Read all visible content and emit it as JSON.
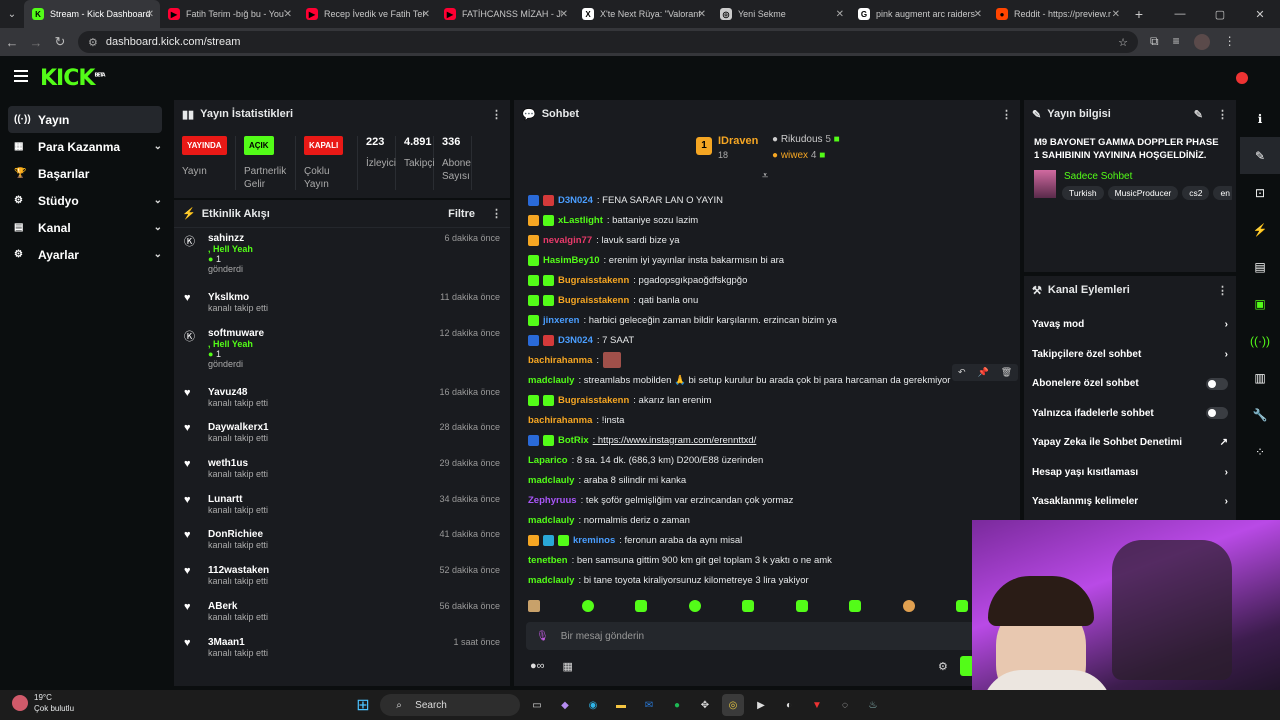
{
  "browser": {
    "tabs": [
      {
        "title": "Stream - Kick Dashboard",
        "fav": "K",
        "color": "#53fc18",
        "active": true
      },
      {
        "title": "Fatih Terim -bığ bu - YouT",
        "fav": "▶",
        "color": "#ff0033"
      },
      {
        "title": "Recep İvedik ve Fatih Teri",
        "fav": "▶",
        "color": "#ff0033"
      },
      {
        "title": "FATİHCANSS MİZAH - JET",
        "fav": "▶",
        "color": "#ff0033"
      },
      {
        "title": "X'te Next Rüya: \"Valorant",
        "fav": "X",
        "color": "#ffffff"
      },
      {
        "title": "Yeni Sekme",
        "fav": "◎",
        "color": "#cccccc"
      },
      {
        "title": "pink augment arc raiders",
        "fav": "G",
        "color": "#ffffff"
      },
      {
        "title": "Reddit - https://preview.r",
        "fav": "●",
        "color": "#ff4500"
      }
    ],
    "url": "dashboard.kick.com/stream"
  },
  "logo": {
    "text": "KICK",
    "beta": "BETA"
  },
  "sidebar": {
    "items": [
      {
        "label": "Yayın",
        "icon": "broadcast-icon",
        "glyph": "((·))",
        "active": true,
        "chevron": false
      },
      {
        "label": "Para Kazanma",
        "icon": "money-icon",
        "glyph": "▦",
        "chevron": true
      },
      {
        "label": "Başarılar",
        "icon": "trophy-icon",
        "glyph": "🏆",
        "chevron": false
      },
      {
        "label": "Stüdyo",
        "icon": "studio-icon",
        "glyph": "⚙",
        "chevron": true
      },
      {
        "label": "Kanal",
        "icon": "channel-icon",
        "glyph": "▤",
        "chevron": true
      },
      {
        "label": "Ayarlar",
        "icon": "settings-icon",
        "glyph": "⚙",
        "chevron": true
      }
    ]
  },
  "stats_panel": {
    "title": "Yayın İstatistikleri",
    "items": [
      {
        "badge": "YAYINDA",
        "badge_color": "#e91916",
        "label": "Yayın"
      },
      {
        "badge": "AÇIK",
        "badge_color": "#53fc18",
        "label": "Partnerlik Gelir Programı"
      },
      {
        "badge": "KAPALI",
        "badge_color": "#e91916",
        "label": "Çoklu Yayın"
      },
      {
        "num": "223",
        "label": "İzleyici"
      },
      {
        "num": "4.891",
        "label": "Takipçi"
      },
      {
        "num": "336",
        "label": "Abone Sayısı"
      }
    ]
  },
  "activity": {
    "title": "Etkinlik Akışı",
    "filter": "Filtre",
    "items": [
      {
        "name": "sahinzz",
        "type": "gift",
        "gift_name": ", Hell Yeah",
        "gift_count": "1",
        "action": "gönderdi",
        "time": "6 dakika önce"
      },
      {
        "name": "Ykslkmo",
        "type": "follow",
        "action": "kanalı takip etti",
        "time": "11 dakika önce"
      },
      {
        "name": "softmuware",
        "type": "gift",
        "gift_name": ", Hell Yeah",
        "gift_count": "1",
        "action": "gönderdi",
        "time": "12 dakika önce"
      },
      {
        "name": "Yavuz48",
        "type": "follow",
        "action": "kanalı takip etti",
        "time": "16 dakika önce"
      },
      {
        "name": "Daywalkerx1",
        "type": "follow",
        "action": "kanalı takip etti",
        "time": "28 dakika önce"
      },
      {
        "name": "weth1us",
        "type": "follow",
        "action": "kanalı takip etti",
        "time": "29 dakika önce"
      },
      {
        "name": "Lunartt",
        "type": "follow",
        "action": "kanalı takip etti",
        "time": "34 dakika önce"
      },
      {
        "name": "DonRichiee",
        "type": "follow",
        "action": "kanalı takip etti",
        "time": "41 dakika önce"
      },
      {
        "name": "112wastaken",
        "type": "follow",
        "action": "kanalı takip etti",
        "time": "52 dakika önce"
      },
      {
        "name": "ABerk",
        "type": "follow",
        "action": "kanalı takip etti",
        "time": "56 dakika önce"
      },
      {
        "name": "3Maan1",
        "type": "follow",
        "action": "kanalı takip etti",
        "time": "1 saat önce"
      }
    ]
  },
  "chat": {
    "title": "Sohbet",
    "top": {
      "first": {
        "name": "IDraven",
        "rank": "1",
        "count": "18"
      },
      "second": {
        "name": "Rikudous",
        "count": "5"
      },
      "third": {
        "name": "wiwex",
        "count": "4"
      }
    },
    "messages": [
      {
        "user": "D3N024",
        "color": "#4a9eff",
        "badges": [
          "#2a6ad8",
          "#d43a3a"
        ],
        "text": ": FENA SARAR LAN O YAYIN"
      },
      {
        "user": "xLastlight",
        "color": "#53fc18",
        "badges": [
          "#f5a623",
          "#53fc18"
        ],
        "text": ": battaniye sozu lazim"
      },
      {
        "user": "nevalgin77",
        "color": "#e83a6a",
        "badges": [
          "#f5a623"
        ],
        "text": ": lavuk sardi bize ya"
      },
      {
        "user": "HasimBey10",
        "color": "#53fc18",
        "badges": [
          "#53fc18"
        ],
        "text": ": erenim iyi yayınlar insta bakarmısın bi ara"
      },
      {
        "user": "Bugraisstakenn",
        "color": "#f5a623",
        "badges": [
          "#53fc18",
          "#53fc18"
        ],
        "text": ": pgadopsgıkpaoğdfskgpğo"
      },
      {
        "user": "Bugraisstakenn",
        "color": "#f5a623",
        "badges": [
          "#53fc18",
          "#53fc18"
        ],
        "text": ": qati banla onu"
      },
      {
        "user": "jinxeren",
        "color": "#4a9eff",
        "badges": [
          "#53fc18"
        ],
        "text": ": harbici geleceğin zaman bildir karşılarım. erzincan bizim ya"
      },
      {
        "user": "D3N024",
        "color": "#4a9eff",
        "badges": [
          "#2a6ad8",
          "#d43a3a"
        ],
        "text": ": 7 SAAT"
      },
      {
        "user": "bachirahanma",
        "color": "#f5a623",
        "badges": [],
        "text": ":"
      },
      {
        "user": "madclauly",
        "color": "#53fc18",
        "badges": [],
        "text": ": streamlabs mobilden 🙏 bi setup kurulur bu arada çok bi para harcaman da gerekmiyor"
      },
      {
        "user": "Bugraisstakenn",
        "color": "#f5a623",
        "badges": [
          "#53fc18",
          "#53fc18"
        ],
        "text": ": akarız lan erenim"
      },
      {
        "user": "bachirahanma",
        "color": "#f5a623",
        "badges": [],
        "text": ": !insta"
      },
      {
        "user": "BotRix",
        "color": "#53fc18",
        "badges": [
          "#2a6ad8",
          "#53fc18"
        ],
        "text": ": https://www.instagram.com/erennttxd/"
      },
      {
        "user": "Laparico",
        "color": "#53fc18",
        "badges": [],
        "text": ": 8 sa. 14 dk. (686,3 km) D200/E88 üzerinden"
      },
      {
        "user": "madclauly",
        "color": "#53fc18",
        "badges": [],
        "text": ": araba 8 silindir mi kanka"
      },
      {
        "user": "Zephyruus",
        "color": "#a855f7",
        "badges": [],
        "text": ": tek şoför gelmişliğim var erzincandan çok yormaz"
      },
      {
        "user": "madclauly",
        "color": "#53fc18",
        "badges": [],
        "text": ": normalmis deriz o zaman"
      },
      {
        "user": "kreminos",
        "color": "#4a9eff",
        "badges": [
          "#f5a623",
          "#2aa8d8",
          "#53fc18"
        ],
        "text": ": feronun araba da aynı misal"
      },
      {
        "user": "tenetben",
        "color": "#53fc18",
        "badges": [],
        "text": ": ben samsuna gittim 900 km git gel toplam 3 k yaktı o ne amk"
      },
      {
        "user": "madclauly",
        "color": "#53fc18",
        "badges": [],
        "text": ": bi tane toyota kiraliyorsunuz kilometreye 3 lira yakiyor"
      }
    ],
    "input_placeholder": "Bir mesaj gönderin"
  },
  "stream_info": {
    "title": "Yayın bilgisi",
    "stream_title": "M9 BAYONET GAMMA DOPPLER PHASE 1 SAHIBININ YAYININA HOŞGELDİNİZ.",
    "category": "Sadece Sohbet",
    "tags": [
      "Turkish",
      "MusicProducer",
      "cs2",
      "en"
    ]
  },
  "channel_actions": {
    "title": "Kanal Eylemleri",
    "items": [
      {
        "label": "Yavaş mod",
        "end": "›"
      },
      {
        "label": "Takipçilere özel sohbet",
        "end": "›"
      },
      {
        "label": "Abonelere özel sohbet",
        "end": "toggle"
      },
      {
        "label": "Yalnızca ifadelerle sohbet",
        "end": "toggle"
      },
      {
        "label": "Yapay Zeka ile Sohbet Denetimi",
        "end": "↗"
      },
      {
        "label": "Hesap yaşı kısıtlaması",
        "end": "›"
      },
      {
        "label": "Yasaklanmış kelimeler",
        "end": "›"
      }
    ]
  },
  "taskbar": {
    "weather_temp": "19°C",
    "weather_desc": "Çok bulutlu",
    "search": "Search"
  }
}
